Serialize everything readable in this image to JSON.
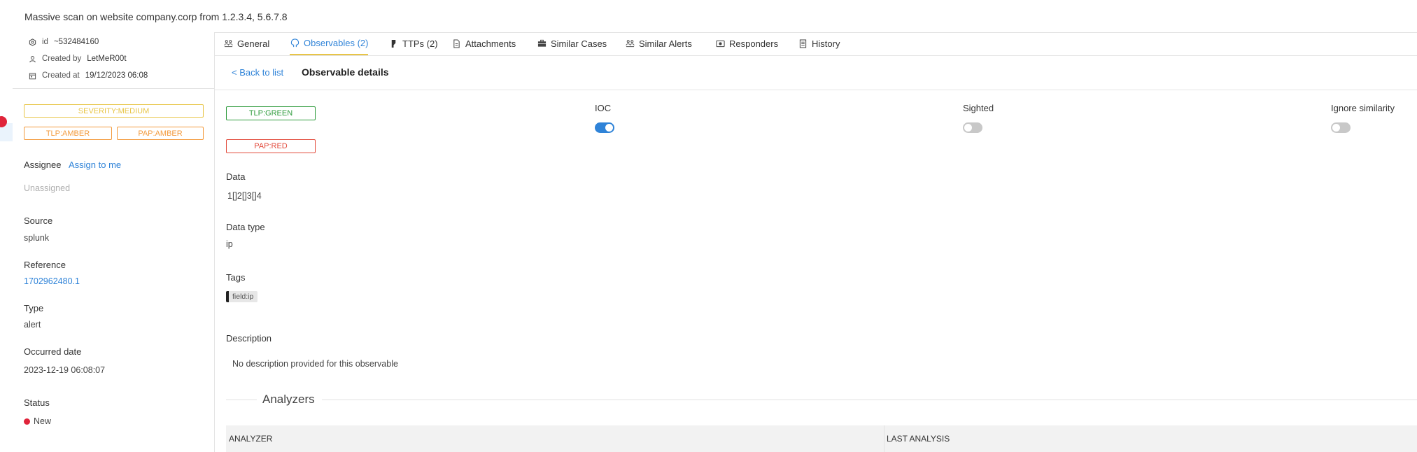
{
  "header": {
    "title": "Massive scan on website company.corp from 1.2.3.4, 5.6.7.8"
  },
  "sidebar": {
    "meta": {
      "id_label": "id",
      "id_value": "~532484160",
      "created_by_label": "Created by",
      "created_by_value": "LetMeR00t",
      "created_at_label": "Created at",
      "created_at_value": "19/12/2023 06:08"
    },
    "badges": {
      "severity": "SEVERITY:MEDIUM",
      "tlp": "TLP:AMBER",
      "pap": "PAP:AMBER"
    },
    "assignee_label": "Assignee",
    "assign_link": "Assign to me",
    "assignee_value": "Unassigned",
    "source_label": "Source",
    "source_value": "splunk",
    "reference_label": "Reference",
    "reference_value": "1702962480.1",
    "type_label": "Type",
    "type_value": "alert",
    "occurred_label": "Occurred date",
    "occurred_value": "2023-12-19 06:08:07",
    "status_label": "Status",
    "status_value": "New",
    "status_color": "#e0243a"
  },
  "tabs": [
    {
      "label": "General",
      "icon": "general-icon"
    },
    {
      "label": "Observables (2)",
      "icon": "observables-icon",
      "active": true
    },
    {
      "label": "TTPs (2)",
      "icon": "ttps-icon"
    },
    {
      "label": "Attachments",
      "icon": "attachment-icon"
    },
    {
      "label": "Similar Cases",
      "icon": "briefcase-icon"
    },
    {
      "label": "Similar Alerts",
      "icon": "alerts-icon"
    },
    {
      "label": "Responders",
      "icon": "responders-icon"
    },
    {
      "label": "History",
      "icon": "history-icon"
    }
  ],
  "subheader": {
    "back": "< Back to list",
    "title": "Observable details"
  },
  "observable": {
    "tlp": "TLP:GREEN",
    "pap": "PAP:RED",
    "ioc_label": "IOC",
    "ioc": true,
    "sighted_label": "Sighted",
    "sighted": false,
    "ignore_label": "Ignore similarity",
    "ignore_similarity": false,
    "data_label": "Data",
    "data_value": "1[]2[]3[]4",
    "datatype_label": "Data type",
    "datatype_value": "ip",
    "tags_label": "Tags",
    "tags": [
      "field:ip"
    ],
    "description_label": "Description",
    "description_value": "No description provided for this observable"
  },
  "analyzers": {
    "title": "Analyzers",
    "columns": [
      "ANALYZER",
      "LAST ANALYSIS"
    ]
  },
  "colors": {
    "accent": "#2f83d8",
    "tab_underline": "#e8c547",
    "severity_medium": "#e8c547",
    "amber": "#f39a3c",
    "green": "#2c9a3a",
    "red": "#e24a3b"
  }
}
